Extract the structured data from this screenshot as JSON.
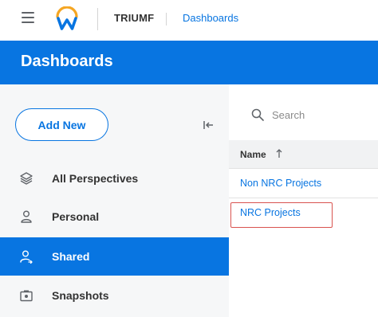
{
  "topbar": {
    "tenant": "TRIUMF",
    "breadcrumb": "Dashboards"
  },
  "header": {
    "title": "Dashboards"
  },
  "sidebar": {
    "add_new_label": "Add New",
    "items": [
      {
        "label": "All Perspectives",
        "icon": "layers-icon",
        "active": false
      },
      {
        "label": "Personal",
        "icon": "person-icon",
        "active": false
      },
      {
        "label": "Shared",
        "icon": "shared-person-icon",
        "active": true
      },
      {
        "label": "Snapshots",
        "icon": "camera-icon",
        "active": false
      }
    ]
  },
  "main": {
    "search_placeholder": "Search",
    "column_header": "Name",
    "rows": [
      "Non NRC Projects",
      "NRC Projects"
    ]
  },
  "colors": {
    "accent": "#0875e1",
    "highlight": "#d9534f",
    "sidebar_bg": "#f6f7f8"
  }
}
